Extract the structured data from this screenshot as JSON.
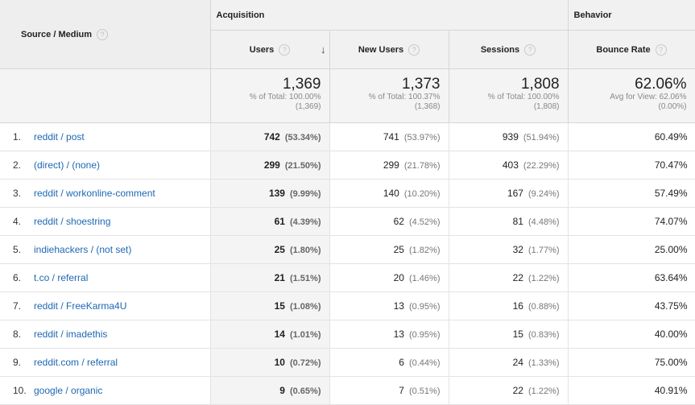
{
  "header": {
    "source_medium": "Source / Medium",
    "group_acquisition": "Acquisition",
    "group_behavior": "Behavior",
    "col_users": "Users",
    "col_new_users": "New Users",
    "col_sessions": "Sessions",
    "col_bounce_rate": "Bounce Rate",
    "help_glyph": "?",
    "sort_glyph": "↓"
  },
  "totals": {
    "users": {
      "value": "1,369",
      "line1": "% of Total: 100.00%",
      "line2": "(1,369)"
    },
    "new_users": {
      "value": "1,373",
      "line1": "% of Total: 100.37%",
      "line2": "(1,368)"
    },
    "sessions": {
      "value": "1,808",
      "line1": "% of Total: 100.00%",
      "line2": "(1,808)"
    },
    "bounce_rate": {
      "value": "62.06%",
      "line1": "Avg for View: 62.06%",
      "line2": "(0.00%)"
    }
  },
  "rows": [
    {
      "idx": "1.",
      "source": "reddit / post",
      "users": "742",
      "users_pct": "(53.34%)",
      "new_users": "741",
      "new_users_pct": "(53.97%)",
      "sessions": "939",
      "sessions_pct": "(51.94%)",
      "bounce": "60.49%"
    },
    {
      "idx": "2.",
      "source": "(direct) / (none)",
      "users": "299",
      "users_pct": "(21.50%)",
      "new_users": "299",
      "new_users_pct": "(21.78%)",
      "sessions": "403",
      "sessions_pct": "(22.29%)",
      "bounce": "70.47%"
    },
    {
      "idx": "3.",
      "source": "reddit / workonline-comment",
      "users": "139",
      "users_pct": "(9.99%)",
      "new_users": "140",
      "new_users_pct": "(10.20%)",
      "sessions": "167",
      "sessions_pct": "(9.24%)",
      "bounce": "57.49%"
    },
    {
      "idx": "4.",
      "source": "reddit / shoestring",
      "users": "61",
      "users_pct": "(4.39%)",
      "new_users": "62",
      "new_users_pct": "(4.52%)",
      "sessions": "81",
      "sessions_pct": "(4.48%)",
      "bounce": "74.07%"
    },
    {
      "idx": "5.",
      "source": "indiehackers / (not set)",
      "users": "25",
      "users_pct": "(1.80%)",
      "new_users": "25",
      "new_users_pct": "(1.82%)",
      "sessions": "32",
      "sessions_pct": "(1.77%)",
      "bounce": "25.00%"
    },
    {
      "idx": "6.",
      "source": "t.co / referral",
      "users": "21",
      "users_pct": "(1.51%)",
      "new_users": "20",
      "new_users_pct": "(1.46%)",
      "sessions": "22",
      "sessions_pct": "(1.22%)",
      "bounce": "63.64%"
    },
    {
      "idx": "7.",
      "source": "reddit / FreeKarma4U",
      "users": "15",
      "users_pct": "(1.08%)",
      "new_users": "13",
      "new_users_pct": "(0.95%)",
      "sessions": "16",
      "sessions_pct": "(0.88%)",
      "bounce": "43.75%"
    },
    {
      "idx": "8.",
      "source": "reddit / imadethis",
      "users": "14",
      "users_pct": "(1.01%)",
      "new_users": "13",
      "new_users_pct": "(0.95%)",
      "sessions": "15",
      "sessions_pct": "(0.83%)",
      "bounce": "40.00%"
    },
    {
      "idx": "9.",
      "source": "reddit.com / referral",
      "users": "10",
      "users_pct": "(0.72%)",
      "new_users": "6",
      "new_users_pct": "(0.44%)",
      "sessions": "24",
      "sessions_pct": "(1.33%)",
      "bounce": "75.00%"
    },
    {
      "idx": "10.",
      "source": "google / organic",
      "users": "9",
      "users_pct": "(0.65%)",
      "new_users": "7",
      "new_users_pct": "(0.51%)",
      "sessions": "22",
      "sessions_pct": "(1.22%)",
      "bounce": "40.91%"
    }
  ]
}
